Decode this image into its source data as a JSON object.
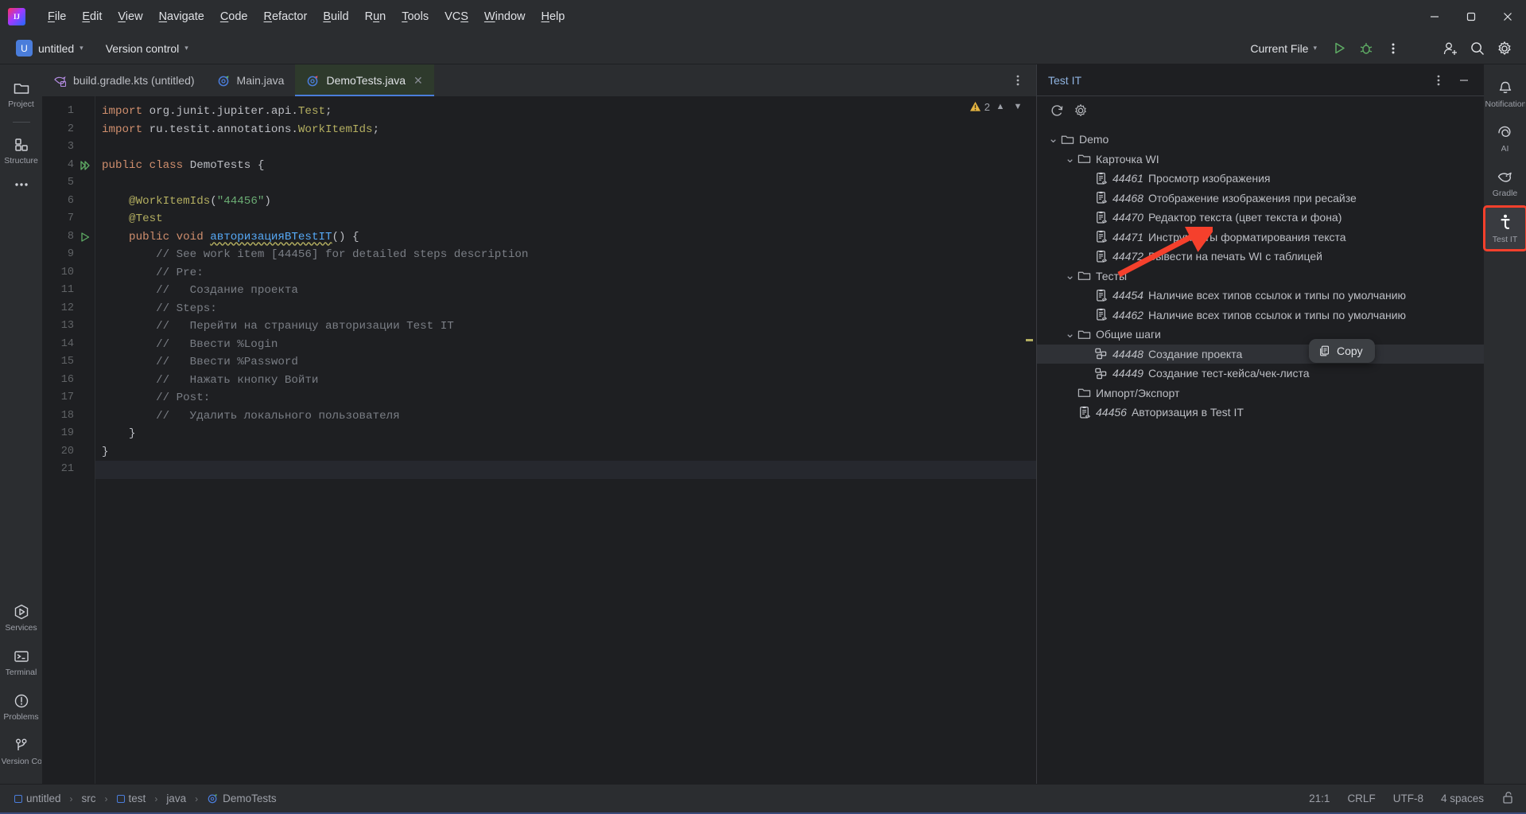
{
  "menubar": {
    "logo": "intellij-logo",
    "items": [
      {
        "label": "File",
        "mnemonic": "F"
      },
      {
        "label": "Edit",
        "mnemonic": "E"
      },
      {
        "label": "View",
        "mnemonic": "V"
      },
      {
        "label": "Navigate",
        "mnemonic": "N"
      },
      {
        "label": "Code",
        "mnemonic": "C"
      },
      {
        "label": "Refactor",
        "mnemonic": "R"
      },
      {
        "label": "Build",
        "mnemonic": "B"
      },
      {
        "label": "Run",
        "mnemonic": "u"
      },
      {
        "label": "Tools",
        "mnemonic": "T"
      },
      {
        "label": "VCS",
        "mnemonic": "S"
      },
      {
        "label": "Window",
        "mnemonic": "W"
      },
      {
        "label": "Help",
        "mnemonic": "H"
      }
    ]
  },
  "toolbar": {
    "project_badge": "U",
    "project_name": "untitled",
    "vcs_label": "Version control",
    "run_config": "Current File",
    "run_button": "run-icon",
    "debug_button": "debug-icon",
    "more_button": "more-vertical-icon",
    "account_button": "account-add-icon",
    "search_button": "search-icon",
    "settings_button": "gear-icon",
    "window_minimize": "minimize-icon",
    "window_maximize": "maximize-icon",
    "window_close": "close-icon"
  },
  "left_stripe": {
    "top": [
      {
        "label": "Project",
        "icon": "folder-icon"
      },
      {
        "label": "Structure",
        "icon": "structure-icon"
      },
      {
        "label": "",
        "icon": "more-horizontal-icon"
      }
    ],
    "bottom": [
      {
        "label": "Services",
        "icon": "services-icon"
      },
      {
        "label": "Terminal",
        "icon": "terminal-icon"
      },
      {
        "label": "Problems",
        "icon": "problems-icon"
      },
      {
        "label": "Version Control",
        "icon": "branch-icon"
      }
    ]
  },
  "right_stripe": {
    "items": [
      {
        "label": "Notifications",
        "icon": "bell-icon",
        "active": false
      },
      {
        "label": "AI",
        "icon": "ai-spiral-icon",
        "active": false
      },
      {
        "label": "Gradle",
        "icon": "gradle-elephant-icon",
        "active": false
      },
      {
        "label": "Test IT",
        "icon": "testit-icon",
        "active": true
      }
    ]
  },
  "editor": {
    "tabs": [
      {
        "label": "build.gradle.kts (untitled)",
        "icon": "gradle-file-icon",
        "active": false,
        "closable": false
      },
      {
        "label": "Main.java",
        "icon": "java-test-class-icon",
        "active": false,
        "closable": false
      },
      {
        "label": "DemoTests.java",
        "icon": "java-test-class-icon",
        "active": true,
        "closable": true
      }
    ],
    "tab_options_icon": "more-vertical-icon",
    "inspection": {
      "count": "2",
      "icon": "warning-triangle-icon",
      "prev": "chevron-up-icon",
      "next": "chevron-down-icon"
    },
    "line_count": 21,
    "current_line": 21,
    "gutter_run_icons": {
      "4": "run-all-tests-icon",
      "8": "run-test-icon"
    },
    "lines": [
      {
        "n": 1,
        "tokens": [
          {
            "t": "import ",
            "c": "k"
          },
          {
            "t": "org.junit.jupiter.api.",
            "c": "ident"
          },
          {
            "t": "Test",
            "c": "ann"
          },
          {
            "t": ";",
            "c": "punc"
          }
        ]
      },
      {
        "n": 2,
        "tokens": [
          {
            "t": "import ",
            "c": "k"
          },
          {
            "t": "ru.testit.annotations.",
            "c": "ident"
          },
          {
            "t": "WorkItemIds",
            "c": "ann"
          },
          {
            "t": ";",
            "c": "punc"
          }
        ]
      },
      {
        "n": 3,
        "tokens": []
      },
      {
        "n": 4,
        "tokens": [
          {
            "t": "public class ",
            "c": "k"
          },
          {
            "t": "DemoTests",
            "c": "ident"
          },
          {
            "t": " {",
            "c": "punc"
          }
        ]
      },
      {
        "n": 5,
        "tokens": []
      },
      {
        "n": 6,
        "tokens": [
          {
            "t": "    @WorkItemIds",
            "c": "ann"
          },
          {
            "t": "(",
            "c": "punc"
          },
          {
            "t": "\"44456\"",
            "c": "str"
          },
          {
            "t": ")",
            "c": "punc"
          }
        ]
      },
      {
        "n": 7,
        "tokens": [
          {
            "t": "    @Test",
            "c": "ann"
          }
        ]
      },
      {
        "n": 8,
        "tokens": [
          {
            "t": "    public void ",
            "c": "k"
          },
          {
            "t": "авторизацияВTestIT",
            "c": "mth mth-spell"
          },
          {
            "t": "() {",
            "c": "punc"
          }
        ]
      },
      {
        "n": 9,
        "tokens": [
          {
            "t": "        // See work item [44456] for detailed steps description",
            "c": "cmt"
          }
        ]
      },
      {
        "n": 10,
        "tokens": [
          {
            "t": "        // Pre:",
            "c": "cmt"
          }
        ]
      },
      {
        "n": 11,
        "tokens": [
          {
            "t": "        //   Создание проекта",
            "c": "cmt"
          }
        ]
      },
      {
        "n": 12,
        "tokens": [
          {
            "t": "        // Steps:",
            "c": "cmt"
          }
        ]
      },
      {
        "n": 13,
        "tokens": [
          {
            "t": "        //   Перейти на страницу авторизации Test IT",
            "c": "cmt"
          }
        ]
      },
      {
        "n": 14,
        "tokens": [
          {
            "t": "        //   Ввести %Login",
            "c": "cmt"
          }
        ]
      },
      {
        "n": 15,
        "tokens": [
          {
            "t": "        //   Ввести %Password",
            "c": "cmt"
          }
        ]
      },
      {
        "n": 16,
        "tokens": [
          {
            "t": "        //   Нажать кнопку Войти",
            "c": "cmt"
          }
        ]
      },
      {
        "n": 17,
        "tokens": [
          {
            "t": "        // Post:",
            "c": "cmt"
          }
        ]
      },
      {
        "n": 18,
        "tokens": [
          {
            "t": "        //   Удалить локального пользователя",
            "c": "cmt"
          }
        ]
      },
      {
        "n": 19,
        "tokens": [
          {
            "t": "    }",
            "c": "punc"
          }
        ]
      },
      {
        "n": 20,
        "tokens": [
          {
            "t": "}",
            "c": "punc"
          }
        ]
      },
      {
        "n": 21,
        "tokens": []
      }
    ]
  },
  "testit_panel": {
    "title": "Test IT",
    "options_icon": "more-vertical-icon",
    "hide_icon": "minimize-icon",
    "refresh_icon": "refresh-icon",
    "settings_icon": "gear-icon",
    "tree": [
      {
        "depth": 0,
        "arrow": "expanded",
        "icon": "folder-rocket-icon",
        "id": "",
        "label": "Demo"
      },
      {
        "depth": 1,
        "arrow": "expanded",
        "icon": "folder-icon",
        "id": "",
        "label": "Карточка WI"
      },
      {
        "depth": 2,
        "arrow": "none",
        "icon": "work-item-icon",
        "id": "44461",
        "label": "Просмотр изображения"
      },
      {
        "depth": 2,
        "arrow": "none",
        "icon": "work-item-icon",
        "id": "44468",
        "label": "Отображение изображения при ресайзе"
      },
      {
        "depth": 2,
        "arrow": "none",
        "icon": "work-item-icon",
        "id": "44470",
        "label": "Редактор текста (цвет текста и фона)"
      },
      {
        "depth": 2,
        "arrow": "none",
        "icon": "work-item-icon",
        "id": "44471",
        "label": "Инструменты форматирования текста"
      },
      {
        "depth": 2,
        "arrow": "none",
        "icon": "work-item-icon",
        "id": "44472",
        "label": "Вывести на печать WI с таблицей"
      },
      {
        "depth": 1,
        "arrow": "expanded",
        "icon": "folder-icon",
        "id": "",
        "label": "Тесты"
      },
      {
        "depth": 2,
        "arrow": "none",
        "icon": "work-item-icon",
        "id": "44454",
        "label": "Наличие всех типов ссылок и типы по умолчанию"
      },
      {
        "depth": 2,
        "arrow": "none",
        "icon": "work-item-icon",
        "id": "44462",
        "label": "Наличие всех типов ссылок и типы по умолчанию"
      },
      {
        "depth": 1,
        "arrow": "expanded",
        "icon": "folder-icon",
        "id": "",
        "label": "Общие шаги"
      },
      {
        "depth": 2,
        "arrow": "none",
        "icon": "shared-step-icon",
        "id": "44448",
        "label": "Создание проекта",
        "selected": true
      },
      {
        "depth": 2,
        "arrow": "none",
        "icon": "shared-step-icon",
        "id": "44449",
        "label": "Создание тест-кейса/чек-листа"
      },
      {
        "depth": 1,
        "arrow": "none",
        "icon": "folder-icon",
        "id": "",
        "label": "Импорт/Экспорт"
      },
      {
        "depth": 1,
        "arrow": "none",
        "icon": "work-item-icon",
        "id": "44456",
        "label": "Авторизация в Test IT"
      }
    ],
    "copy_popup": {
      "label": "Copy",
      "icon": "copy-icon"
    }
  },
  "statusbar": {
    "breadcrumbs": [
      {
        "label": "untitled",
        "icon": "module-icon"
      },
      {
        "label": "src",
        "icon": ""
      },
      {
        "label": "test",
        "icon": "module-icon"
      },
      {
        "label": "java",
        "icon": ""
      },
      {
        "label": "DemoTests",
        "icon": "java-test-class-icon"
      }
    ],
    "separator": "›",
    "caret_position": "21:1",
    "line_separator": "CRLF",
    "encoding": "UTF-8",
    "indent": "4 spaces",
    "lock_icon": "unlocked-icon"
  },
  "annotation": {
    "arrow": "red-arrow-pointing-to-testit-stripe-button",
    "color": "#f5402c"
  }
}
